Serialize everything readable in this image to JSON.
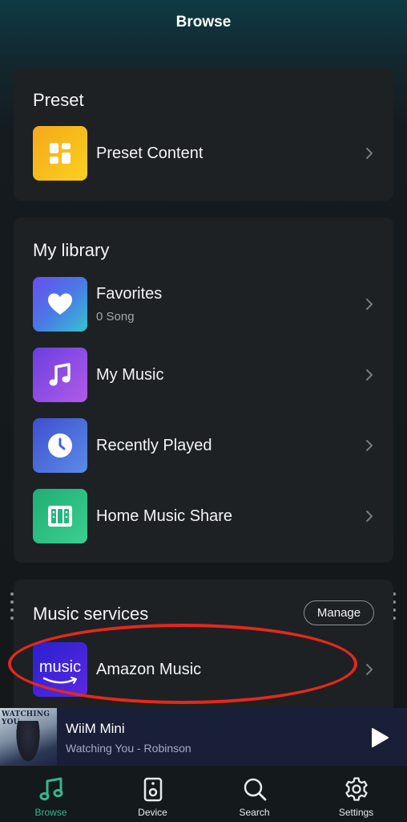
{
  "header": {
    "title": "Browse"
  },
  "preset": {
    "title": "Preset",
    "items": [
      {
        "label": "Preset Content",
        "icon": "preset-grid-icon",
        "color": "#f5b51c"
      }
    ]
  },
  "library": {
    "title": "My library",
    "items": [
      {
        "label": "Favorites",
        "sub": "0  Song",
        "icon": "heart-icon",
        "color": "#5b6fe8"
      },
      {
        "label": "My Music",
        "icon": "music-note-icon",
        "color": "#8e4de8"
      },
      {
        "label": "Recently Played",
        "icon": "clock-icon",
        "color": "#4b6bd9"
      },
      {
        "label": "Home Music Share",
        "icon": "share-grid-icon",
        "color": "#27b57f"
      }
    ]
  },
  "services": {
    "title": "Music services",
    "manage_label": "Manage",
    "items": [
      {
        "label": "Amazon Music",
        "logo_text": "music",
        "icon": "amazon-music-logo",
        "color": "#3a1fd6"
      }
    ]
  },
  "player": {
    "device": "WiiM Mini",
    "track": "Watching You - Robinson",
    "art_text": "WATCHING YOU"
  },
  "tabs": [
    {
      "label": "Browse",
      "icon": "browse-music-icon",
      "active": true
    },
    {
      "label": "Device",
      "icon": "device-speaker-icon"
    },
    {
      "label": "Search",
      "icon": "search-icon"
    },
    {
      "label": "Settings",
      "icon": "gear-icon"
    }
  ],
  "colors": {
    "accent": "#39b48b",
    "highlight": "#e5281b",
    "card": "#1d2124",
    "player": "#1a1f38"
  }
}
